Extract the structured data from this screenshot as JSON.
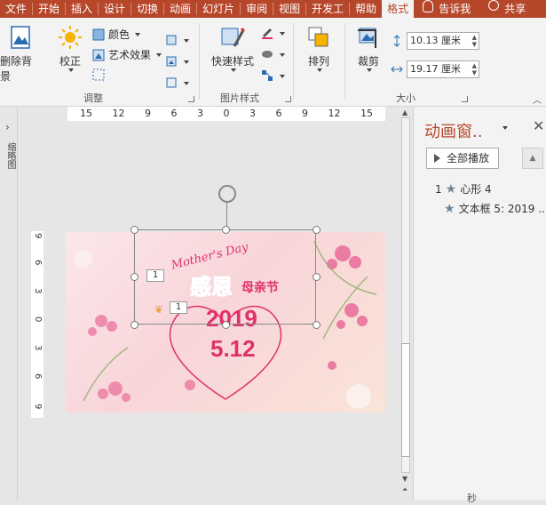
{
  "tabs": [
    "文件",
    "开始",
    "插入",
    "设计",
    "切换",
    "动画",
    "幻灯片",
    "审阅",
    "视图",
    "开发工",
    "帮助",
    "格式"
  ],
  "active_tab": "格式",
  "tell_me": "告诉我",
  "share": "共享",
  "ribbon": {
    "remove_bg": "删除背景",
    "correct": "校正",
    "color": "颜色",
    "art_effects": "艺术效果",
    "group_adjust": "调整",
    "quick_styles": "快速样式",
    "group_picture_styles": "图片样式",
    "arrange": "排列",
    "crop": "裁剪",
    "height_value": "10.13 厘米",
    "width_value": "19.17 厘米",
    "group_size": "大小"
  },
  "left_strip": {
    "label": "缩略图"
  },
  "rulers": {
    "horizontal": [
      "15",
      "12",
      "9",
      "6",
      "3",
      "0",
      "3",
      "6",
      "9",
      "12",
      "15"
    ],
    "vertical": [
      "9",
      "6",
      "3",
      "0",
      "3",
      "6",
      "9"
    ]
  },
  "slide": {
    "script": "Mother's Day",
    "title_big": "感恩",
    "title_small": "母亲节",
    "year": "2019",
    "date": "5.12",
    "tag1": "1",
    "tag2": "1"
  },
  "anim_pane": {
    "title": "动画窗..",
    "play_all": "全部播放",
    "item1_num": "1",
    "item1_label": "心形 4",
    "item2_label": "文本框 5: 2019 ...",
    "bottom": "秒"
  },
  "colors": {
    "accent": "#b7472a",
    "slide_text": "#e0306a"
  }
}
